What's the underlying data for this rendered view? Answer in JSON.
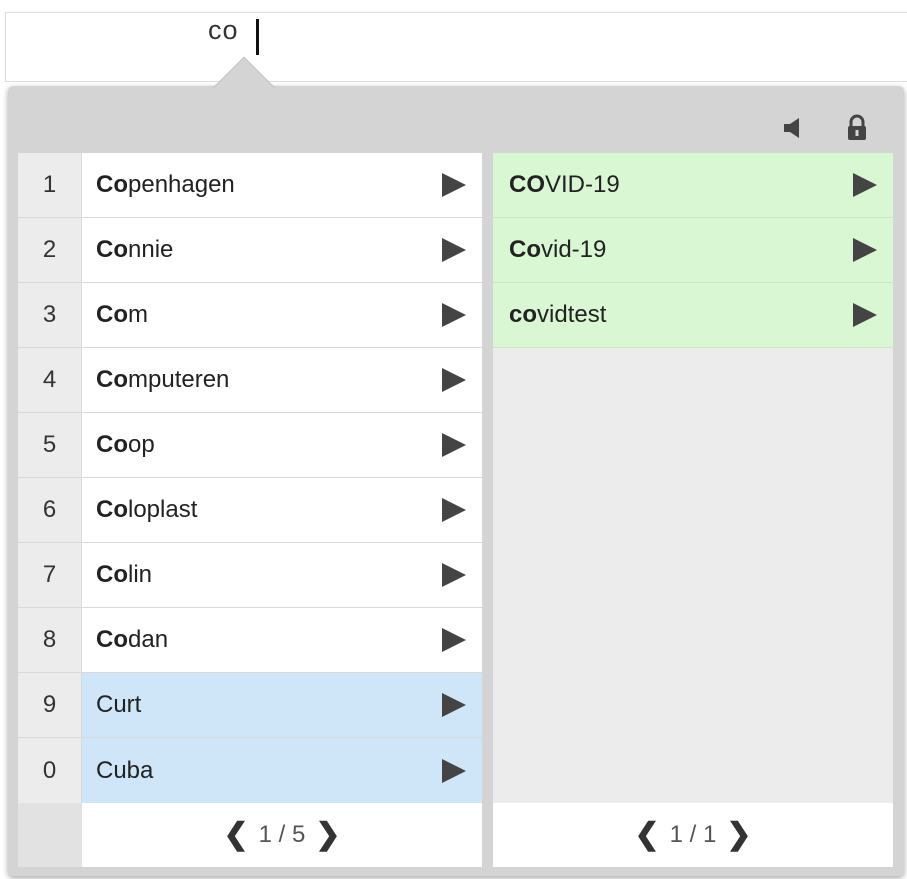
{
  "editor": {
    "typed_text": "co"
  },
  "toolbar": {
    "icons": [
      "speaker-mute-icon",
      "lock-icon"
    ]
  },
  "left_list": {
    "rows": [
      {
        "num": "1",
        "bold": "Co",
        "rest": "penhagen"
      },
      {
        "num": "2",
        "bold": "Co",
        "rest": "nnie"
      },
      {
        "num": "3",
        "bold": "Co",
        "rest": "m"
      },
      {
        "num": "4",
        "bold": "Co",
        "rest": "mputeren"
      },
      {
        "num": "5",
        "bold": "Co",
        "rest": "op"
      },
      {
        "num": "6",
        "bold": "Co",
        "rest": "loplast"
      },
      {
        "num": "7",
        "bold": "Co",
        "rest": "lin"
      },
      {
        "num": "8",
        "bold": "Co",
        "rest": "dan"
      },
      {
        "num": "9",
        "bold": "",
        "rest": "Curt"
      },
      {
        "num": "0",
        "bold": "",
        "rest": "Cuba"
      }
    ],
    "pager": {
      "prev": "❮",
      "text": "1 / 5",
      "next": "❯"
    }
  },
  "right_list": {
    "rows": [
      {
        "bold": "CO",
        "rest": "VID-19"
      },
      {
        "bold": "Co",
        "rest": "vid-19"
      },
      {
        "bold": "co",
        "rest": "vidtest"
      }
    ],
    "pager": {
      "prev": "❮",
      "text": "1 / 1",
      "next": "❯"
    }
  },
  "colors": {
    "blue_highlight": "#cfe6f9",
    "green_highlight": "#d9f7d3",
    "panel_bg": "#d4d4d4"
  }
}
